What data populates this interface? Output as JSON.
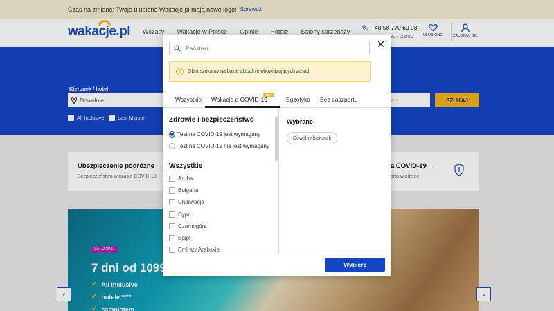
{
  "announcement": {
    "text": "Czas na zmianę: Twoje ulubione Wakacje.pl mają nowe logo!",
    "link": "Sprawdź"
  },
  "header": {
    "logo": "wakacje.pl",
    "nav": [
      "Wczasy",
      "Wakacje w Polsce",
      "Opinie",
      "Hotele",
      "Salony sprzedaży"
    ],
    "phone": "+48 58 770 60 03",
    "hours": "30 - 23:00",
    "favorites_label": "ULUBIONE",
    "login_label": "ZALOGUJ SIĘ"
  },
  "hero": {
    "destination_label": "Kierunek / hotel",
    "destination_value": "Dowolnie",
    "second_field_fragment": "ch",
    "search_button": "SZUKAJ",
    "checkboxes": [
      "All Inclusive",
      "Last Minute"
    ]
  },
  "cards": [
    {
      "title": "Ubezpieczenie podróżne",
      "subtitle": "Bezpieczeństwo w czasie COVID-19"
    },
    {
      "title": "a COVID-19",
      "subtitle": "arto wiedzieć"
    }
  ],
  "promo": {
    "badge": "LATO 2021",
    "headline": "7 dni od 1099",
    "features": [
      "All Inclusive",
      "hotele ****",
      "samolotem"
    ]
  },
  "modal": {
    "search_placeholder": "Państwo",
    "notice": "Ofert szukamy na bazie aktualnie obowiązujących zasad.",
    "tabs": [
      "Wszystkie",
      "Wakacje a COVID-19",
      "Egzotyka",
      "Bez paszportu"
    ],
    "new_badge": "NEW",
    "health_section": {
      "title": "Zdrowie i bezpieczeństwo",
      "options": [
        "Test na COVID-19 jest wymagany",
        "Test na COVID-19 nie jest wymagany"
      ],
      "selected_index": 0
    },
    "all_section": {
      "title": "Wszystkie",
      "countries": [
        "Aruba",
        "Bułgaria",
        "Chorwacja",
        "Cypr",
        "Czarnogóra",
        "Egipt",
        "Emiraty Arabskie"
      ]
    },
    "selected_title": "Wybrane",
    "selected_chip": "Dowolny kierunek",
    "confirm_button": "Wybierz"
  },
  "colors": {
    "brand_blue": "#1446c4",
    "accent_yellow": "#f2b11d",
    "notice_bg": "#fcf3cf",
    "promo_badge": "#a42bb0"
  }
}
